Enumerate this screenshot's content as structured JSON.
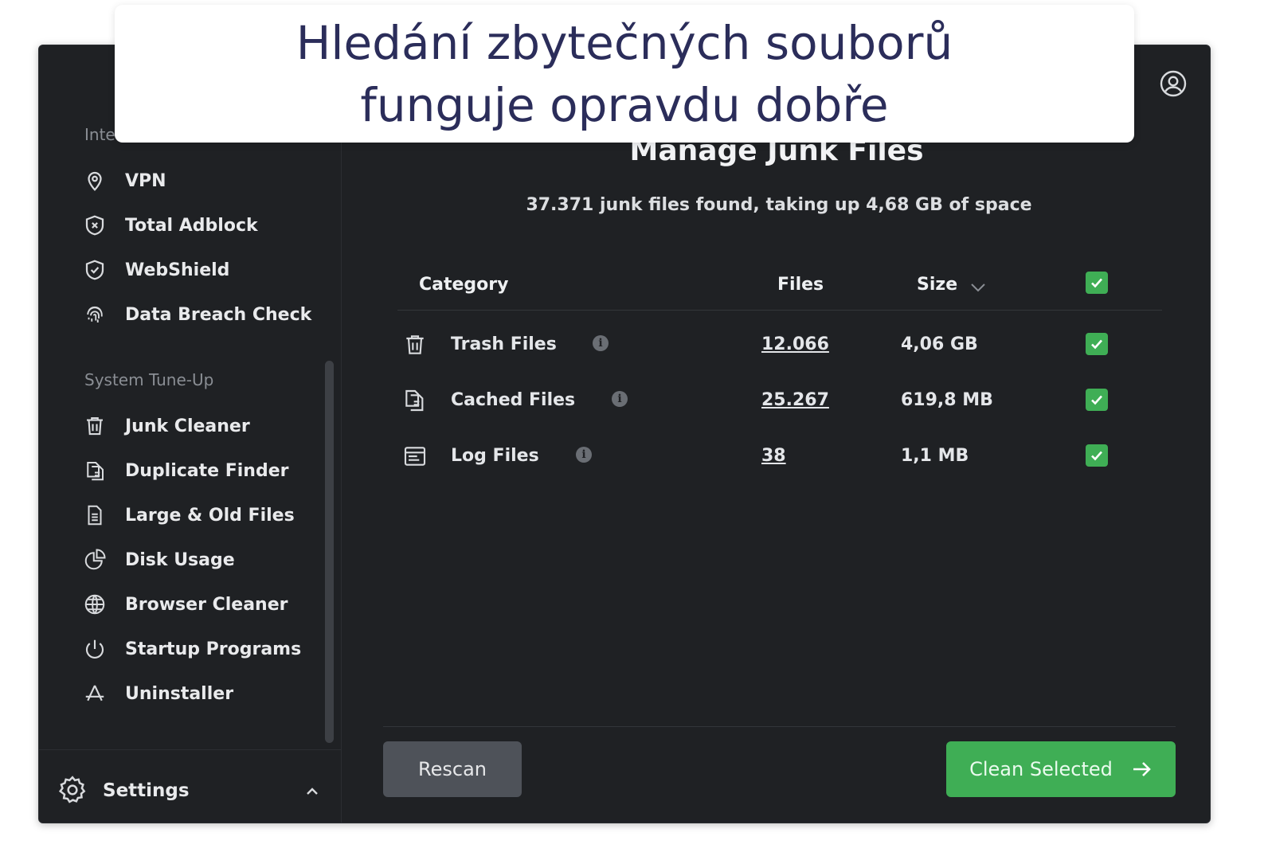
{
  "caption": {
    "text": "Hledání zbytečných souborů\nfunguje opravdu dobře"
  },
  "window": {
    "traffic_colors": [
      "#ee5b51",
      "#f3bc3a",
      "#3a3d41"
    ]
  },
  "sidebar": {
    "section_internet_partial": "Inte",
    "internet_items": [
      {
        "label": "VPN",
        "icon": "location-pin-icon"
      },
      {
        "label": "Total Adblock",
        "icon": "shield-x-icon"
      },
      {
        "label": "WebShield",
        "icon": "shield-check-icon"
      },
      {
        "label": "Data Breach Check",
        "icon": "fingerprint-icon"
      }
    ],
    "section_tuneup": "System Tune-Up",
    "tuneup_items": [
      {
        "label": "Junk Cleaner",
        "icon": "trash-icon"
      },
      {
        "label": "Duplicate Finder",
        "icon": "duplicate-files-icon"
      },
      {
        "label": "Large & Old Files",
        "icon": "document-icon"
      },
      {
        "label": "Disk Usage",
        "icon": "pie-chart-icon"
      },
      {
        "label": "Browser Cleaner",
        "icon": "globe-icon"
      },
      {
        "label": "Startup Programs",
        "icon": "power-icon"
      },
      {
        "label": "Uninstaller",
        "icon": "app-store-icon"
      }
    ],
    "settings_label": "Settings"
  },
  "main": {
    "title": "Manage Junk Files",
    "subtitle": "37.371 junk files found, taking up 4,68 GB of space",
    "headers": {
      "category": "Category",
      "files": "Files",
      "size": "Size"
    },
    "rows": [
      {
        "name": "Trash Files",
        "files": "12.066",
        "size": "4,06 GB",
        "icon": "trash-icon",
        "checked": true
      },
      {
        "name": "Cached Files",
        "files": "25.267",
        "size": "619,8 MB",
        "icon": "cached-files-icon",
        "checked": true
      },
      {
        "name": "Log Files",
        "files": "38",
        "size": "1,1 MB",
        "icon": "log-files-icon",
        "checked": true
      }
    ],
    "rescan_label": "Rescan",
    "clean_label": "Clean Selected"
  },
  "colors": {
    "accent_green": "#3fae55",
    "background": "#1f2124",
    "caption_text": "#2b2d5a"
  }
}
